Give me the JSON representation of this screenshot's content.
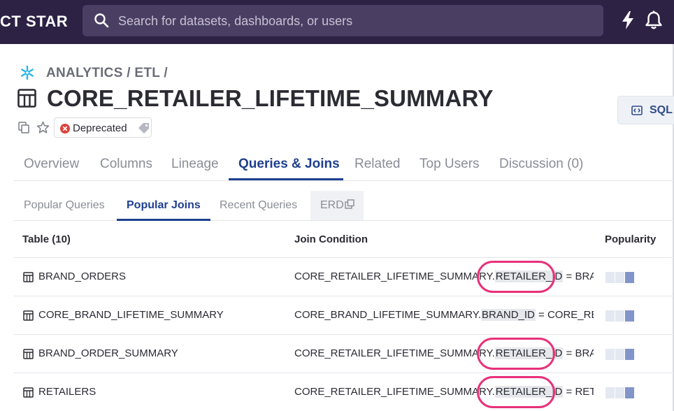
{
  "topbar": {
    "brand": "CT STAR",
    "search_placeholder": "Search for datasets, dashboards, or users",
    "icons": [
      "search-icon",
      "bolt-icon",
      "bell-icon"
    ],
    "background_color": "#2d2144"
  },
  "dataset": {
    "breadcrumb": "ANALYTICS / ETL /",
    "title": "CORE_RETAILER_LIFETIME_SUMMARY",
    "status_badge": "Deprecated",
    "sql_button": "SQL"
  },
  "tabs": [
    {
      "label": "Overview",
      "active": false
    },
    {
      "label": "Columns",
      "active": false
    },
    {
      "label": "Lineage",
      "active": false
    },
    {
      "label": "Queries & Joins",
      "active": true
    },
    {
      "label": "Related",
      "active": false
    },
    {
      "label": "Top Users",
      "active": false
    },
    {
      "label": "Discussion (0)",
      "active": false
    }
  ],
  "subtabs": [
    {
      "label": "Popular Queries",
      "active": false
    },
    {
      "label": "Popular Joins",
      "active": true
    },
    {
      "label": "Recent Queries",
      "active": false
    },
    {
      "label": "ERD",
      "active": false
    }
  ],
  "table": {
    "headers": {
      "table": "Table (10)",
      "join_condition": "Join Condition",
      "popularity": "Popularity"
    },
    "rows": [
      {
        "table": "BRAND_ORDERS",
        "cond_prefix": "CORE_RETAILER_LIFETIME_SUMMARY.",
        "cond_key": "RETAILER_ID",
        "cond_suffix": " = BRAND_ORDERS.RETAILER_ID",
        "popularity_level": 1,
        "highlighted": true
      },
      {
        "table": "CORE_BRAND_LIFETIME_SUMMARY",
        "cond_prefix": "CORE_BRAND_LIFETIME_SUMMARY.",
        "cond_key": "BRAND_ID",
        "cond_suffix": " = CORE_RETAILER_LIFETIME_SUMMARY",
        "popularity_level": 1,
        "highlighted": false
      },
      {
        "table": "BRAND_ORDER_SUMMARY",
        "cond_prefix": "CORE_RETAILER_LIFETIME_SUMMARY.",
        "cond_key": "RETAILER_ID",
        "cond_suffix": " = BRAND_ORDER_SUMMARY",
        "popularity_level": 1,
        "highlighted": true
      },
      {
        "table": "RETAILERS",
        "cond_prefix": "CORE_RETAILER_LIFETIME_SUMMARY.",
        "cond_key": "RETAILER_ID",
        "cond_suffix": " = RETAILERS.ID",
        "popularity_level": 1,
        "highlighted": true
      }
    ]
  },
  "colors": {
    "accent": "#1f3f8f",
    "annotation_circle": "#e8307a",
    "popularity_filled": "#8295c9",
    "popularity_empty": "#e3e8f2",
    "deprecated": "#e0413a"
  }
}
